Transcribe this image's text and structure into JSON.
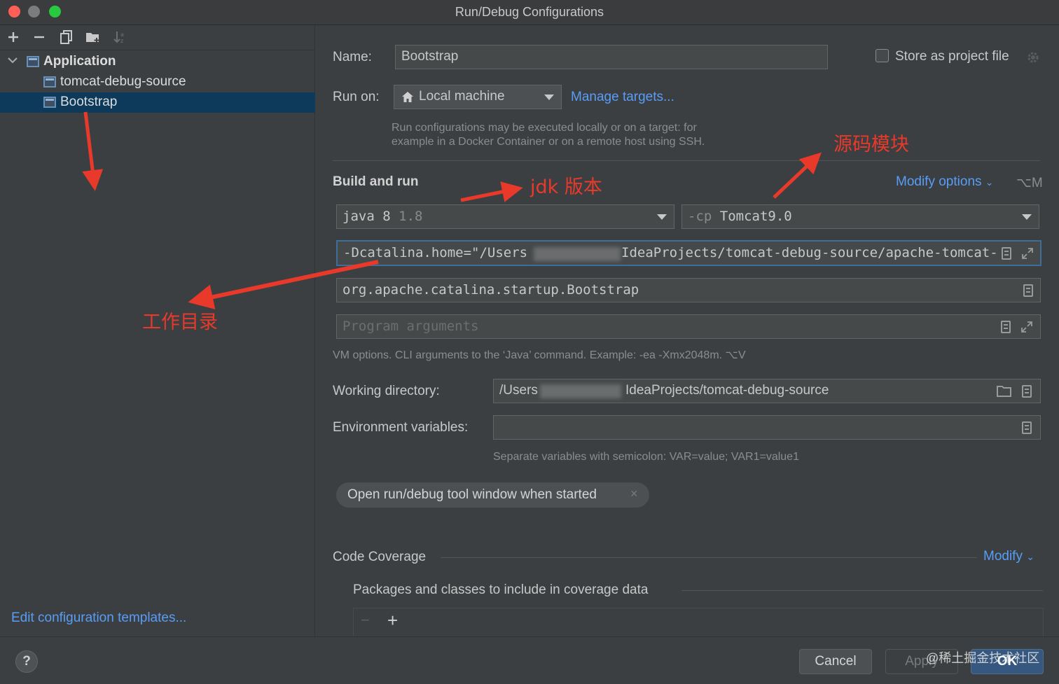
{
  "window": {
    "title": "Run/Debug Configurations"
  },
  "tree": {
    "items": [
      {
        "label": "Application",
        "type": "group",
        "expanded": true
      },
      {
        "label": "tomcat-debug-source",
        "type": "config"
      },
      {
        "label": "Bootstrap",
        "type": "config",
        "selected": true
      }
    ],
    "edit_templates_label": "Edit configuration templates..."
  },
  "form": {
    "name_label": "Name:",
    "name_value": "Bootstrap",
    "store_label": "Store as project file",
    "store_checked": false,
    "run_on_label": "Run on:",
    "run_on_value": "Local machine",
    "manage_targets": "Manage targets...",
    "run_on_hint_1": "Run configurations may be executed locally or on a target: for",
    "run_on_hint_2": "example in a Docker Container or on a remote host using SSH.",
    "build_and_run": "Build and run",
    "modify_options": "Modify options",
    "modify_options_shortcut": "⌥M",
    "jdk_java": "java",
    "jdk_version": "8",
    "jdk_detail": "1.8",
    "cp_prefix": "-cp",
    "cp_value": "Tomcat9.0",
    "vm_options_start": "-Dcatalina.home=\"/Users",
    "vm_options_end": "IdeaProjects/tomcat-debug-source/apache-tomcat-",
    "main_class": "org.apache.catalina.startup.Bootstrap",
    "program_args_placeholder": "Program arguments",
    "vm_hint": "VM options. CLI arguments to the ‘Java’ command. Example: -ea -Xmx2048m. ⌥V",
    "working_dir_label": "Working directory:",
    "working_dir_start": "/Users",
    "working_dir_end": "IdeaProjects/tomcat-debug-source",
    "env_label": "Environment variables:",
    "env_value": "",
    "env_hint": "Separate variables with semicolon: VAR=value; VAR1=value1",
    "chip_label": "Open run/debug tool window when started",
    "chip_close": "×",
    "code_coverage": "Code Coverage",
    "modify": "Modify",
    "coverage_packages": "Packages and classes to include in coverage data",
    "coverage_remove": "−",
    "coverage_add": "+"
  },
  "buttons": {
    "help": "?",
    "cancel": "Cancel",
    "apply": "Apply",
    "ok": "OK"
  },
  "watermark": "@稀土掘金技术社区",
  "annotations": {
    "jdk": "jdk 版本",
    "source_module": "源码模块",
    "working_dir": "工作目录",
    "color": "#e8392a"
  },
  "colors": {
    "accent_link": "#589df6",
    "selection": "#0d3a5b",
    "ok_button": "#365880"
  }
}
